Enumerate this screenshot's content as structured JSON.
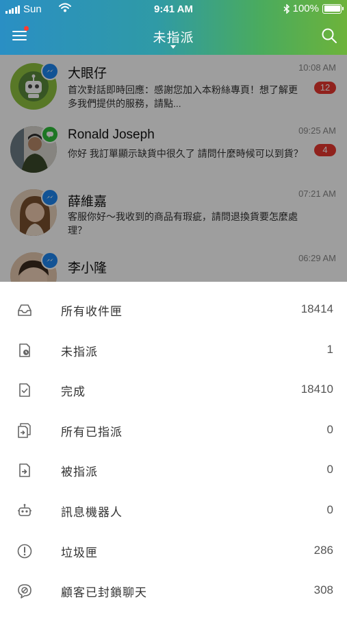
{
  "status_bar": {
    "carrier": "Sun",
    "time": "9:41 AM",
    "battery": "100%"
  },
  "nav": {
    "title": "未指派"
  },
  "conversations": [
    {
      "name": "大眼仔",
      "time": "10:08 AM",
      "preview": "首次對話即時回應：感謝您加入本粉絲專頁！想了解更多我們提供的服務，請點...",
      "unread": "12",
      "channel": "messenger"
    },
    {
      "name": "Ronald Joseph",
      "time": "09:25 AM",
      "preview": "你好 我訂單顯示缺貨中很久了 請問什麼時候可以到貨？",
      "unread": "4",
      "channel": "line"
    },
    {
      "name": "薛維嘉",
      "time": "07:21 AM",
      "preview": "客服你好～我收到的商品有瑕疵，請問退換貨要怎麼處理？",
      "unread": "",
      "channel": "messenger"
    },
    {
      "name": "李小隆",
      "time": "06:29 AM",
      "preview": "",
      "unread": "",
      "channel": "messenger"
    }
  ],
  "inbox_menu": [
    {
      "label": "所有收件匣",
      "count": "18414",
      "icon": "inbox-icon"
    },
    {
      "label": "未指派",
      "count": "1",
      "icon": "unassigned-clock-icon"
    },
    {
      "label": "完成",
      "count": "18410",
      "icon": "done-check-icon"
    },
    {
      "label": "所有已指派",
      "count": "0",
      "icon": "all-assigned-icon"
    },
    {
      "label": "被指派",
      "count": "0",
      "icon": "assigned-to-me-icon"
    },
    {
      "label": "訊息機器人",
      "count": "0",
      "icon": "bot-icon"
    },
    {
      "label": "垃圾匣",
      "count": "286",
      "icon": "spam-alert-icon"
    },
    {
      "label": "顧客已封鎖聊天",
      "count": "308",
      "icon": "blocked-chat-icon"
    }
  ],
  "colors": {
    "header_start": "#2a8fc4",
    "header_end": "#6db33a",
    "unread_badge": "#e8372f",
    "messenger": "#1e86f0",
    "line": "#2fbf3a"
  }
}
